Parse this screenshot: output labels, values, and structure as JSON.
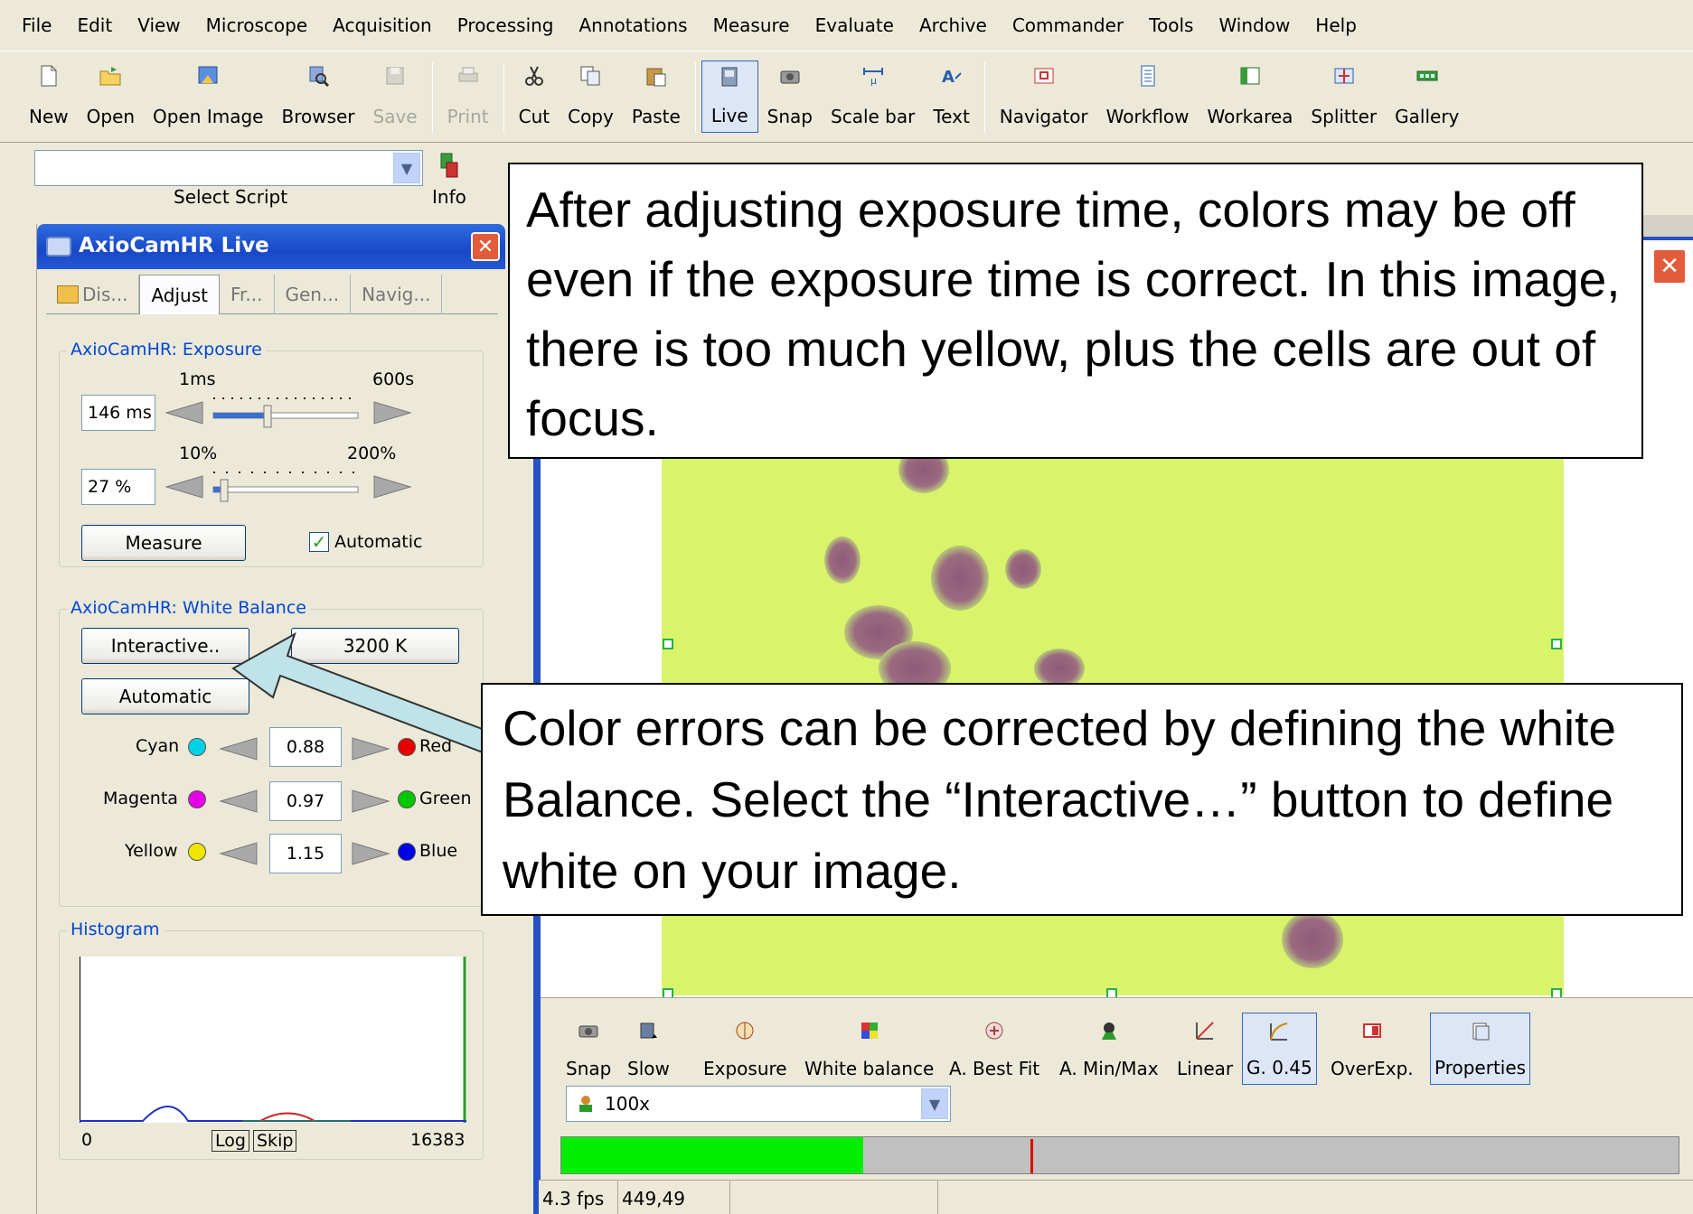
{
  "menubar": [
    "File",
    "Edit",
    "View",
    "Microscope",
    "Acquisition",
    "Processing",
    "Annotations",
    "Measure",
    "Evaluate",
    "Archive",
    "Commander",
    "Tools",
    "Window",
    "Help"
  ],
  "toolbar": {
    "new": "New",
    "open": "Open",
    "open_image": "Open Image",
    "browser": "Browser",
    "save": "Save",
    "print": "Print",
    "cut": "Cut",
    "copy": "Copy",
    "paste": "Paste",
    "live": "Live",
    "snap": "Snap",
    "scale_bar": "Scale bar",
    "text": "Text",
    "navigator": "Navigator",
    "workflow": "Workflow",
    "workarea": "Workarea",
    "splitter": "Splitter",
    "gallery": "Gallery"
  },
  "scriptbar": {
    "select_value": "",
    "select_label": "Select Script",
    "info_label": "Info"
  },
  "live_panel": {
    "title": "AxioCamHR Live",
    "tabs": [
      "Dis...",
      "Adjust",
      "Fr...",
      "Gen...",
      "Navig..."
    ],
    "exposure": {
      "group_title": "AxioCamHR: Exposure",
      "time_min": "1ms",
      "time_max": "600s",
      "time_value": "146 ms",
      "gain_min": "10%",
      "gain_max": "200%",
      "gain_value": "27 %",
      "measure_label": "Measure",
      "automatic_label": "Automatic",
      "automatic_checked": true
    },
    "white_balance": {
      "group_title": "AxioCamHR: White Balance",
      "interactive_label": "Interactive..",
      "temp_label": "3200 K",
      "automatic_label": "Automatic",
      "rows": [
        {
          "left": "Cyan",
          "right": "Red",
          "value": "0.88",
          "left_color": "#00d2e6",
          "right_color": "#e60000"
        },
        {
          "left": "Magenta",
          "right": "Green",
          "value": "0.97",
          "left_color": "#e600e6",
          "right_color": "#00c800"
        },
        {
          "left": "Yellow",
          "right": "Blue",
          "value": "1.15",
          "left_color": "#f0e600",
          "right_color": "#0000e6"
        }
      ]
    },
    "histogram": {
      "group_title": "Histogram",
      "min_label": "0",
      "max_label": "16383",
      "log_label": "Log",
      "skip_label": "Skip"
    }
  },
  "live_toolbar": {
    "snap": "Snap",
    "slow": "Slow",
    "exposure": "Exposure",
    "white_balance": "White balance",
    "best_fit": "A. Best Fit",
    "min_max": "A. Min/Max",
    "linear": "Linear",
    "gamma": "G. 0.45",
    "overexp": "OverExp.",
    "properties": "Properties"
  },
  "objective": {
    "value": "100x"
  },
  "progress": {
    "fill_fraction": 0.27,
    "marker_fraction": 0.42
  },
  "status": {
    "fps": "4.3 fps",
    "coords": "449,49"
  },
  "callouts": {
    "top": "After adjusting exposure time, colors may be off even if the exposure time is correct. In this image, there is too much yellow, plus the cells are out of focus.",
    "bottom": "Color errors can be corrected by defining the white Balance.  Select the “Interactive…” button to define white on your image."
  },
  "colors": {
    "accent": "#2651c6",
    "image_bg": "#d9f46a",
    "arrow_fill": "#bfe3e8"
  }
}
